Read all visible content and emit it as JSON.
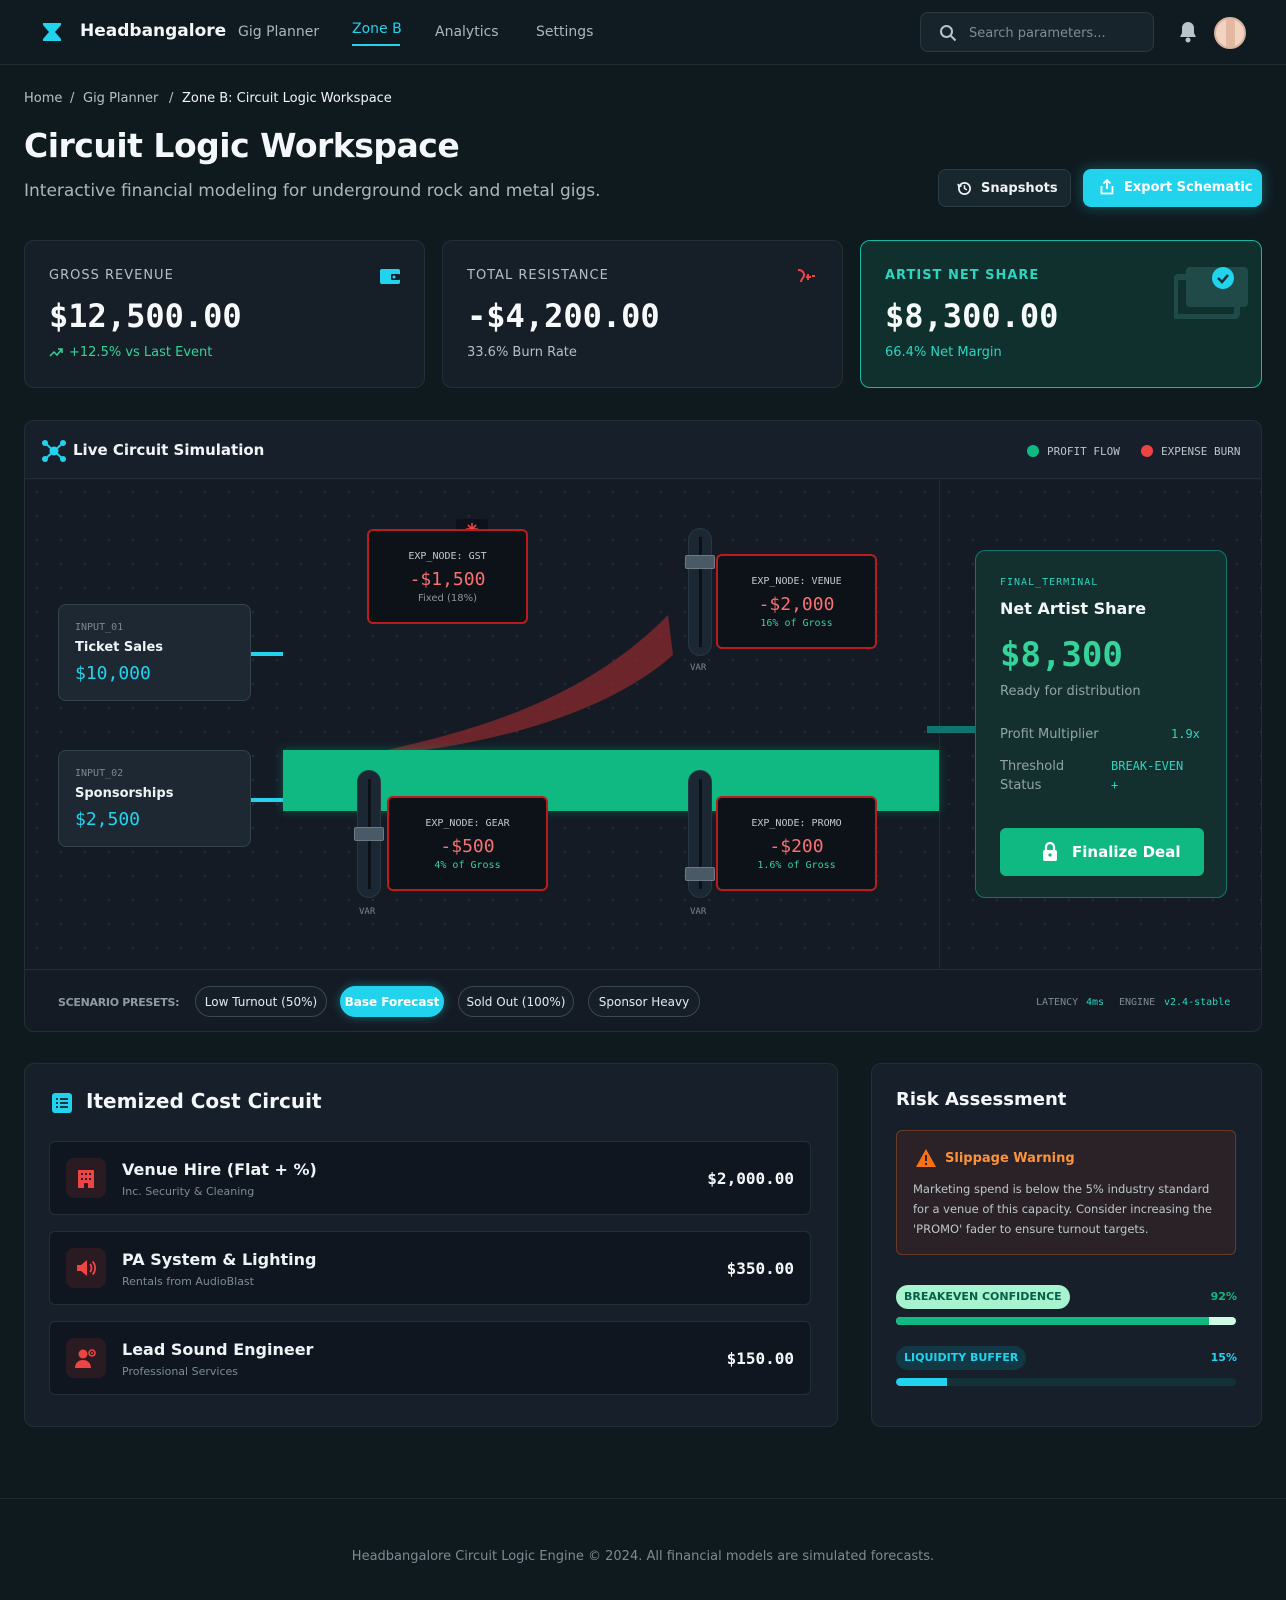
{
  "nav": {
    "brand": "Headbangalore",
    "links": [
      "Gig Planner",
      "Zone B",
      "Analytics",
      "Settings"
    ],
    "active": "Zone B",
    "search_placeholder": "Search parameters...",
    "icons": {
      "logo": "hourglass-logo-icon",
      "search": "search-icon",
      "notifications": "bell-icon"
    }
  },
  "breadcrumb": [
    "Home",
    "Gig Planner",
    "Zone B: Circuit Logic Workspace"
  ],
  "header": {
    "title": "Circuit Logic Workspace",
    "subtitle": "Interactive financial modeling for underground rock and metal gigs.",
    "snapshots_label": "Snapshots",
    "export_label": "Export Schematic"
  },
  "stats": [
    {
      "label": "GROSS REVENUE",
      "value": "$12,500.00",
      "sub": "+12.5% vs Last Event",
      "icon": "wallet-icon"
    },
    {
      "label": "TOTAL RESISTANCE",
      "value": "-$4,200.00",
      "sub": "33.6% Burn Rate",
      "icon": "plug-icon"
    },
    {
      "label": "ARTIST NET SHARE",
      "value": "$8,300.00",
      "sub": "66.4% Net Margin",
      "icon": "money-check-icon"
    }
  ],
  "simulation": {
    "title": "Live Circuit Simulation",
    "legend": [
      "PROFIT FLOW",
      "EXPENSE BURN"
    ],
    "inputs": [
      {
        "key": "INPUT_01",
        "name": "Ticket Sales",
        "value": "$10,000"
      },
      {
        "key": "INPUT_02",
        "name": "Sponsorships",
        "value": "$2,500"
      }
    ],
    "expenses": {
      "gst": {
        "key": "EXP_NODE: GST",
        "value": "-$1,500",
        "sub": "Fixed (18%)"
      },
      "venue": {
        "key": "EXP_NODE: VENUE",
        "value": "-$2,000",
        "sub": "16% of Gross"
      },
      "gear": {
        "key": "EXP_NODE: GEAR",
        "value": "-$500",
        "sub": "4% of Gross"
      },
      "promo": {
        "key": "EXP_NODE: PROMO",
        "value": "-$200",
        "sub": "1.6% of Gross"
      }
    },
    "var_label": "VAR",
    "faders": {
      "venue": 0.8,
      "gear": 0.5,
      "promo": 0.1
    },
    "terminal": {
      "key": "FINAL_TERMINAL",
      "name": "Net Artist Share",
      "value": "$8,300",
      "status": "Ready for distribution",
      "multiplier_label": "Profit Multiplier",
      "multiplier_value": "1.9x",
      "threshold_label_1": "Threshold",
      "threshold_label_2": "Status",
      "threshold_value_1": "BREAK-EVEN",
      "threshold_value_2": "+",
      "finalize_label": "Finalize Deal"
    },
    "presets_label": "SCENARIO PRESETS:",
    "presets": [
      "Low Turnout (50%)",
      "Base Forecast",
      "Sold Out (100%)",
      "Sponsor Heavy"
    ],
    "active_preset": "Base Forecast",
    "latency_label": "LATENCY",
    "latency_value": "4ms",
    "engine_label": "ENGINE",
    "engine_value": "v2.4-stable"
  },
  "costs": {
    "title": "Itemized Cost Circuit",
    "items": [
      {
        "name": "Venue Hire (Flat + %)",
        "desc": "Inc. Security & Cleaning",
        "amount": "$2,000.00",
        "icon": "building-icon"
      },
      {
        "name": "PA System & Lighting",
        "desc": "Rentals from AudioBlast",
        "amount": "$350.00",
        "icon": "speaker-icon"
      },
      {
        "name": "Lead Sound Engineer",
        "desc": "Professional Services",
        "amount": "$150.00",
        "icon": "engineer-icon"
      }
    ]
  },
  "risk": {
    "title": "Risk Assessment",
    "warning_title": "Slippage Warning",
    "warning_body": "Marketing spend is below the 5% industry standard for a venue of this capacity. Consider increasing the 'PROMO' fader to ensure turnout targets.",
    "metrics": [
      {
        "label": "BREAKEVEN CONFIDENCE",
        "percent_label": "92%",
        "value": 0.92
      },
      {
        "label": "LIQUIDITY BUFFER",
        "percent_label": "15%",
        "value": 0.15
      }
    ]
  },
  "footer": "Headbangalore Circuit Logic Engine © 2024. All financial models are simulated forecasts.",
  "colors": {
    "accent": "#22d3ee",
    "profit": "#10b981",
    "expense": "#ef4444",
    "warning": "#fb923c"
  }
}
